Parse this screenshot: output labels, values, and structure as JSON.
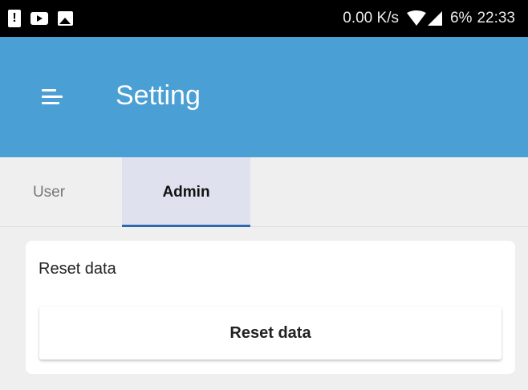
{
  "status_bar": {
    "speed": "0.00 K/s",
    "battery": "6%",
    "time": "22:33",
    "left_icons": [
      "alert-icon",
      "youtube-icon",
      "image-icon"
    ],
    "right_icons": [
      "wifi-icon",
      "signal-icon"
    ]
  },
  "app_bar": {
    "title": "Setting",
    "menu_icon": "menu-icon",
    "color": "#4a9fd5"
  },
  "tabs": [
    {
      "label": "User",
      "active": false
    },
    {
      "label": "Admin",
      "active": true
    }
  ],
  "tab_indicator_color": "#2e67b2",
  "card": {
    "title": "Reset data",
    "button_label": "Reset data"
  }
}
